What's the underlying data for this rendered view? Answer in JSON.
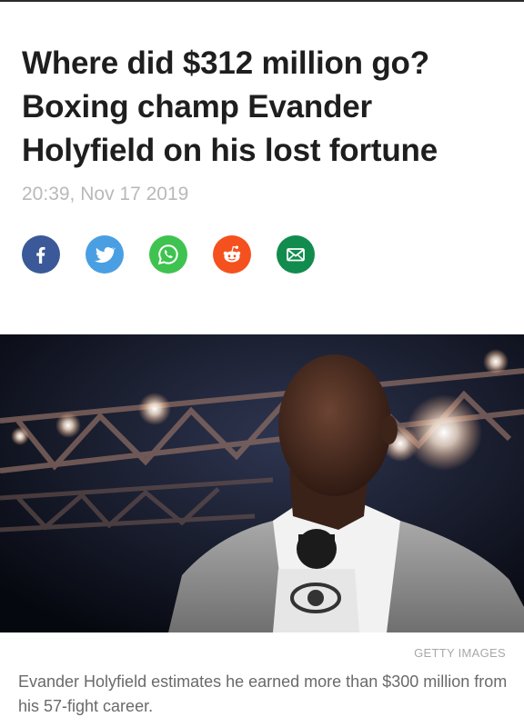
{
  "article": {
    "headline": "Where did $312 million go? Boxing champ Evander Holyfield on his lost fortune",
    "timestamp": "20:39, Nov 17 2019"
  },
  "share": {
    "buttons": [
      {
        "icon": "facebook-icon",
        "color": "#3b5998"
      },
      {
        "icon": "twitter-icon",
        "color": "#4a9fe3"
      },
      {
        "icon": "whatsapp-icon",
        "color": "#3fc350"
      },
      {
        "icon": "reddit-icon",
        "color": "#f4511e"
      },
      {
        "icon": "email-icon",
        "color": "#118c4e"
      }
    ]
  },
  "image": {
    "credit": "GETTY IMAGES",
    "caption": "Evander Holyfield estimates he earned more than $300 million from his 57-fight career."
  }
}
